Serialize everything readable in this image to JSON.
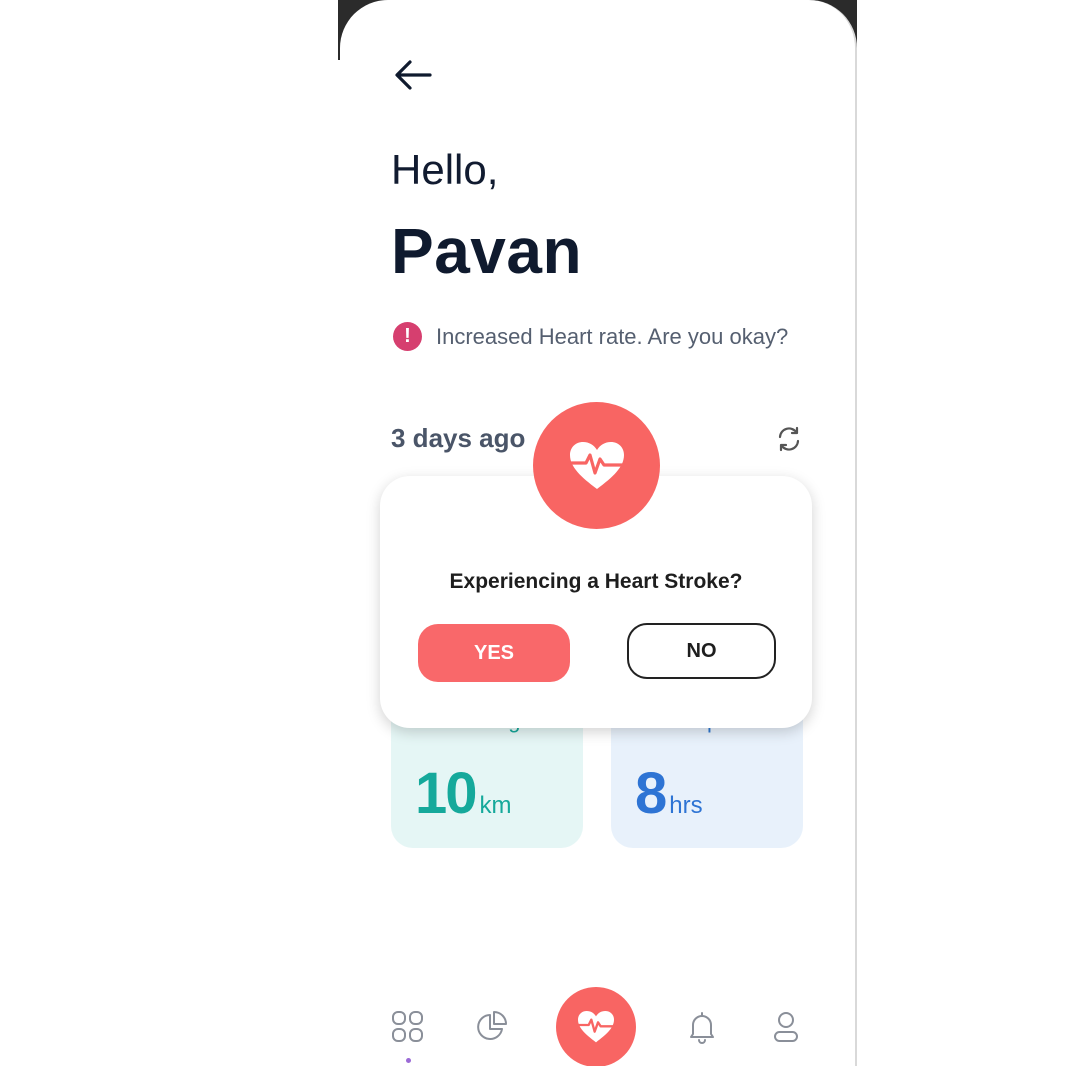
{
  "greeting": {
    "hello": "Hello,",
    "name": "Pavan"
  },
  "alert": {
    "icon": "exclamation-icon",
    "icon_glyph": "!",
    "text": "Increased Heart rate. Are you okay?",
    "color": "#d63f6f"
  },
  "history": {
    "label": "3 days ago",
    "refresh_icon": "refresh-icon"
  },
  "cards": {
    "walking": {
      "label": "Walking",
      "value": "10",
      "unit": "km",
      "color": "#15a99b"
    },
    "sleep": {
      "label": "Sleep",
      "value": "8",
      "unit": "hrs",
      "color": "#2e74d4"
    }
  },
  "dialog": {
    "icon": "heart-pulse-icon",
    "title": "Experiencing a Heart Stroke?",
    "yes_label": "YES",
    "no_label": "NO",
    "accent": "#f86563"
  },
  "nav": {
    "items": [
      {
        "icon": "grid-icon",
        "active": true
      },
      {
        "icon": "pie-chart-icon"
      },
      {
        "icon": "heart-pulse-icon"
      },
      {
        "icon": "bell-icon"
      },
      {
        "icon": "user-icon"
      }
    ]
  }
}
